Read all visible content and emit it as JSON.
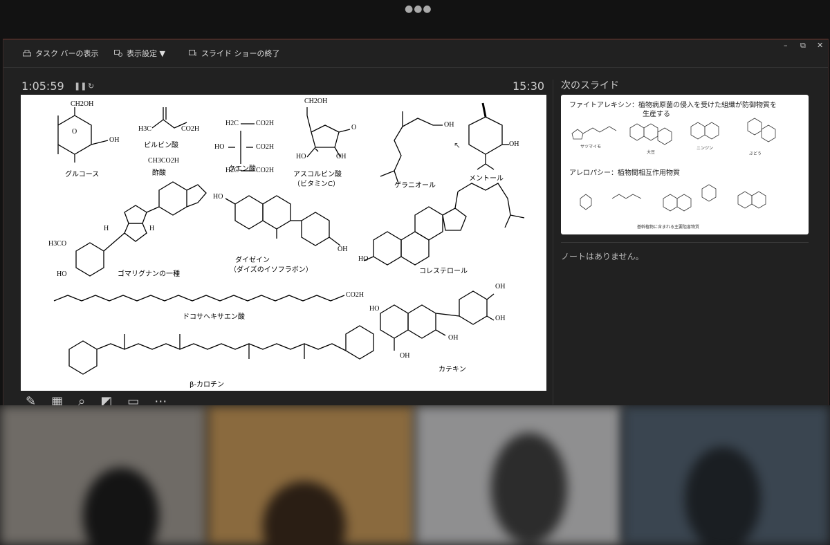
{
  "toolbar": {
    "taskbar_label": "タスク バーの表示",
    "display_settings_label": "表示設定 ▼",
    "end_show_label": "スライド ショーの終了"
  },
  "window_controls": {
    "minimize": "–",
    "restore": "⧉",
    "close": "✕"
  },
  "presenter": {
    "elapsed_time": "1:05:59",
    "pause_icon": "pause-icon",
    "reset_icon": "reset-icon",
    "clock": "15:30",
    "next_slide_title": "次のスライド",
    "notes_text": "ノートはありません。"
  },
  "current_slide": {
    "labels": {
      "glucose": "グルコース",
      "pyruvic": "ピルビン酸",
      "acetic_formula": "CH3CO2H",
      "acetic": "酢酸",
      "citric": "クエン酸",
      "ascorbic": "アスコルビン酸",
      "vitc": "（ビタミンC）",
      "geraniol": "ゲラニオール",
      "menthol": "メントール",
      "lignan": "ゴマリグナンの一種",
      "daidzein": "ダイゼイン",
      "isoflavone": "（ダイズのイソフラボン）",
      "cholesterol": "コレステロール",
      "dha": "ドコサヘキサエン酸",
      "catechin": "カテキン",
      "carotene": "β-カロチン"
    },
    "atoms": {
      "ch2oh": "CH2OH",
      "oh": "OH",
      "o": "O",
      "h3c": "H3C",
      "co2h": "CO2H",
      "h2c": "H2C",
      "ho": "HO",
      "h": "H",
      "h3co": "H3CO"
    }
  },
  "next_slide": {
    "phytoalexin_line1": "ファイトアレキシン：植物病原菌の侵入を受けた組織が防御物質を",
    "phytoalexin_line2": "生産する",
    "small_labels": [
      "サツマイモ",
      "大豆",
      "ニンジン",
      "ぶどう"
    ],
    "allelopathy": "アレロパシー：植物間相互作用物質",
    "allelopathy_caption": "基幹植物に含まれる主要阻害物質"
  },
  "tools": [
    "pen-icon",
    "grid-icon",
    "search-icon",
    "pointer-icon",
    "subtitle-icon",
    "more-icon"
  ]
}
